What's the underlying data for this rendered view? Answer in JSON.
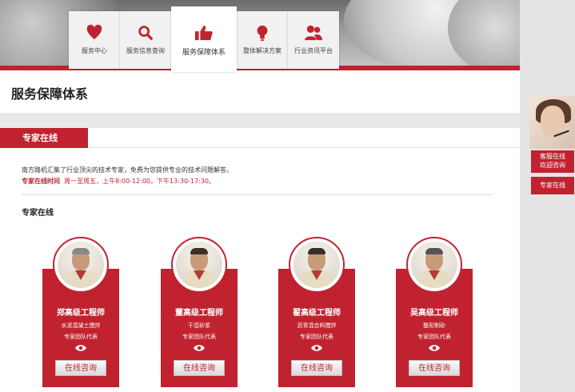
{
  "nav": {
    "tabs": [
      {
        "label": "服务中心",
        "icon": "heart-icon"
      },
      {
        "label": "服务信息查询",
        "icon": "search-icon"
      },
      {
        "label": "服务保障体系",
        "icon": "thumbs-up-icon",
        "active": true
      },
      {
        "label": "整体解决方案",
        "icon": "lightbulb-icon"
      },
      {
        "label": "行业资讯平台",
        "icon": "users-icon"
      }
    ]
  },
  "page": {
    "title": "服务保障体系",
    "section_tab": "专家在线",
    "intro": "南方路机汇集了行业顶尖的技术专家，免费为您提供专业的技术问题解答。",
    "hours_label": "专家在线时间",
    "hours_value": "周一至周五，上午8:00-12:00，下午13:30-17:30。",
    "subsection": "专家在线"
  },
  "experts": [
    {
      "name": "郑高级工程师",
      "specialty": "水泥混凝土搅拌",
      "team": "专家团队代表",
      "button": "在线咨询"
    },
    {
      "name": "董高级工程师",
      "specialty": "干混砂浆",
      "team": "专家团队代表",
      "button": "在线咨询"
    },
    {
      "name": "翟高级工程师",
      "specialty": "沥青混合料搅拌",
      "team": "专家团队代表",
      "button": "在线咨询"
    },
    {
      "name": "吴高级工程师",
      "specialty": "整形制砂",
      "team": "专家团队代表",
      "button": "在线咨询"
    }
  ],
  "sidebar": {
    "service_line1": "客服在线",
    "service_line2": "欢迎咨询",
    "expert_label": "专家在线"
  },
  "colors": {
    "accent": "#c0232f"
  }
}
